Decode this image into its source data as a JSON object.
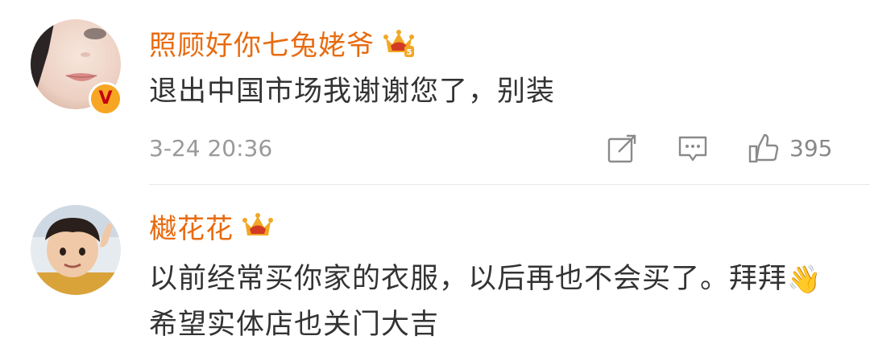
{
  "comments": [
    {
      "username": "照顾好你七兔姥爷",
      "text": "退出中国市场我谢谢您了，别装",
      "date": "3-24 20:36",
      "likes": "395",
      "verified": true,
      "verified_glyph": "V",
      "avatar": "face-closeup",
      "badge": "crown-level-5"
    },
    {
      "username": "樾花花",
      "text_part1": "以前经常买你家的衣服，以后再也不会买了。拜拜",
      "emoji": "👋",
      "text_part2": "希望实体店也关门大吉",
      "avatar": "child-photo",
      "badge": "crown"
    }
  ],
  "colors": {
    "username": "#e86b0f",
    "text": "#333333",
    "meta": "#999999",
    "icon": "#8a8a8a",
    "crown_gold": "#f2a825",
    "crown_red": "#d23a23",
    "verified_bg": "#f6a623"
  }
}
